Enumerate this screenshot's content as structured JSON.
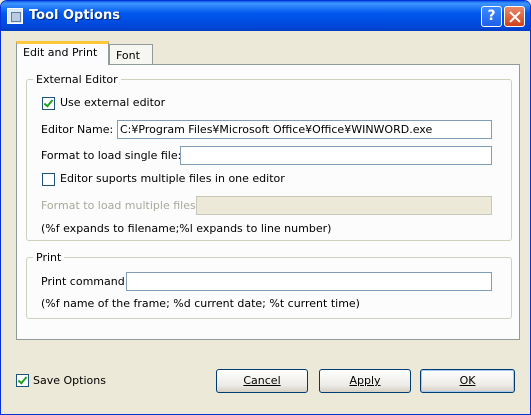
{
  "window": {
    "title": "Tool Options",
    "help_label": "?"
  },
  "tabs": [
    {
      "label": "Edit and Print",
      "active": true
    },
    {
      "label": "Font",
      "active": false
    }
  ],
  "external_editor": {
    "group_label": "External Editor",
    "use_external_label": "Use external editor",
    "use_external_checked": true,
    "editor_name_label": "Editor Name:",
    "editor_name_value": "C:¥Program Files¥Microsoft Office¥Office¥WINWORD.exe",
    "format_single_label": "Format to load single file:",
    "format_single_value": "",
    "multi_label": "Editor suports multiple files in one editor",
    "multi_checked": false,
    "format_multiple_label": "Format to load multiple files:",
    "format_multiple_value": "",
    "hint": "(%f expands to filename;%l expands to line number)"
  },
  "print": {
    "group_label": "Print",
    "command_label": "Print command:",
    "command_value": "",
    "hint": "(%f name of the frame; %d current date; %t current time)"
  },
  "footer": {
    "save_options_label": "Save Options",
    "save_options_checked": true,
    "cancel_label": "Cancel",
    "apply_label": "Apply",
    "ok_label": "OK"
  }
}
